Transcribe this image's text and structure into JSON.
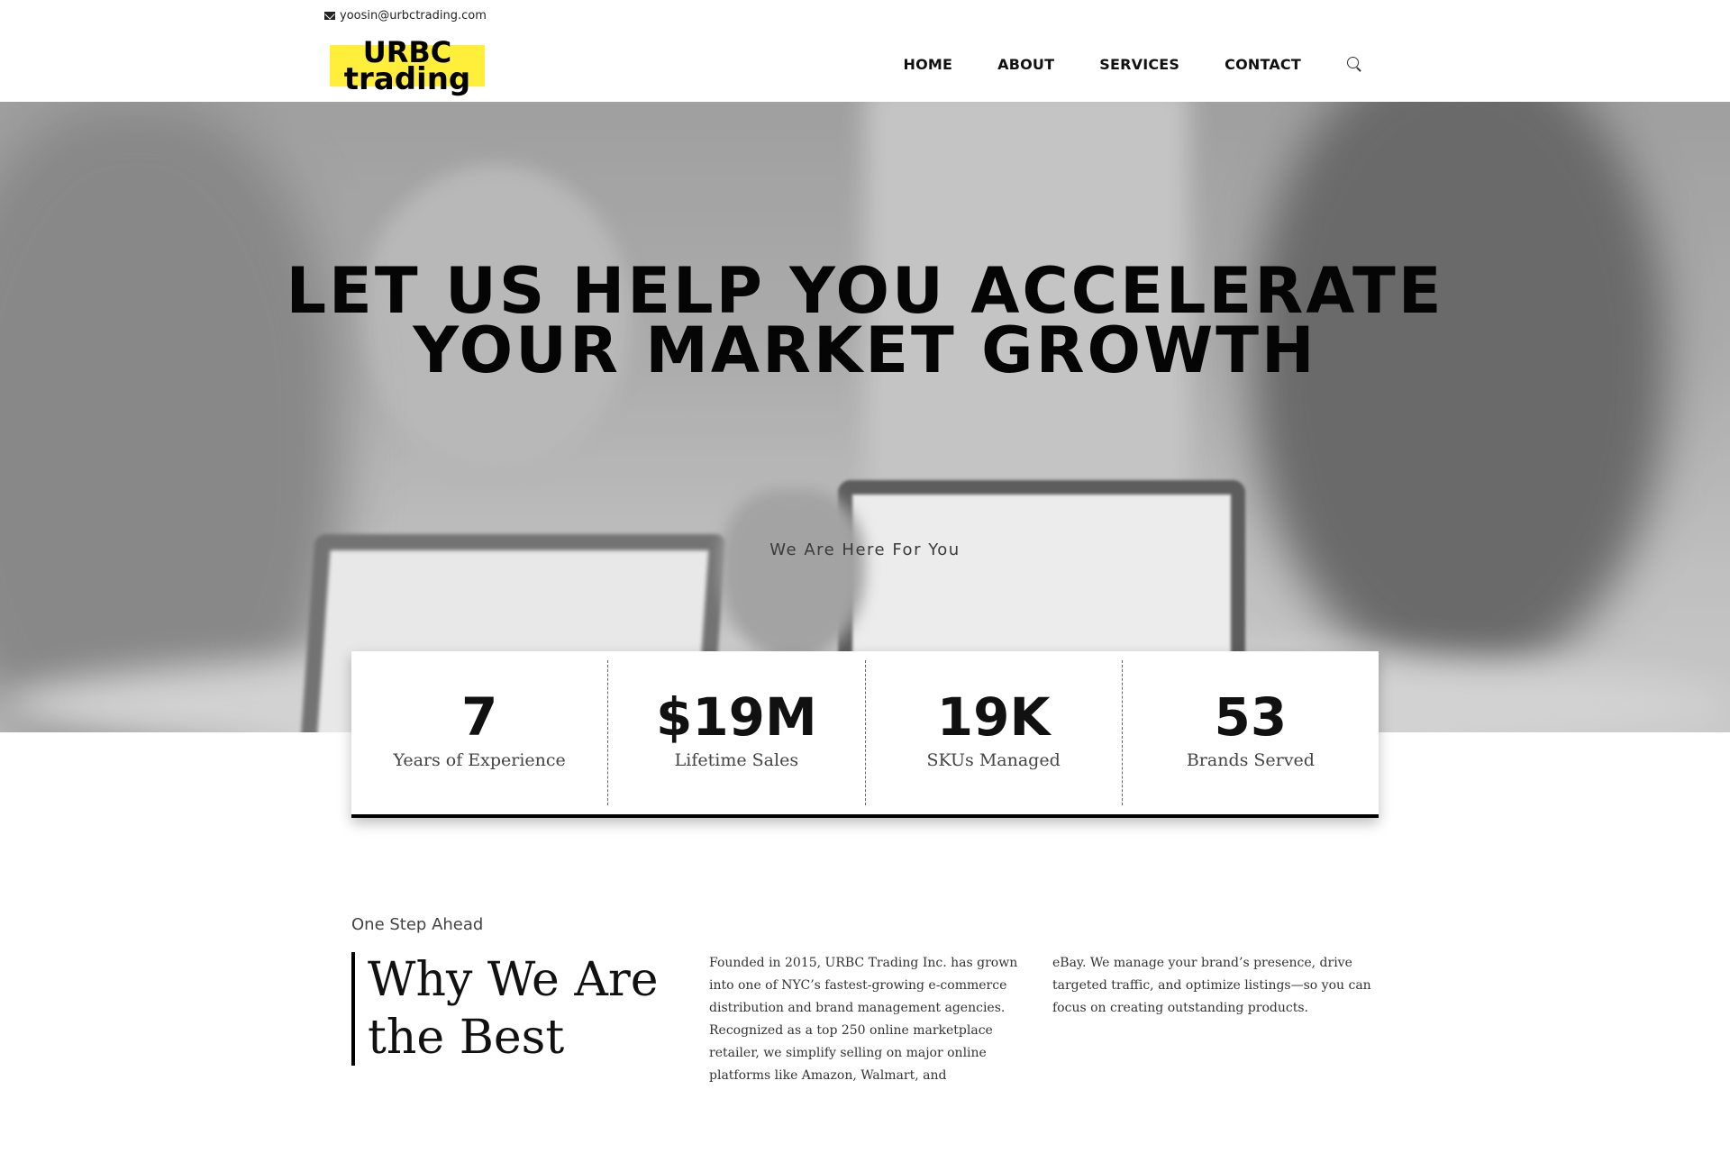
{
  "topbar": {
    "email": "yoosin@urbctrading.com"
  },
  "logo": {
    "line1": "URBC",
    "line2": "trading",
    "highlight_color": "#ffef3a"
  },
  "nav": {
    "items": [
      "HOME",
      "ABOUT",
      "SERVICES",
      "CONTACT"
    ],
    "search_icon": "search-icon"
  },
  "hero": {
    "title_line1": "LET US HELP YOU ACCELERATE",
    "title_line2": "YOUR MARKET GROWTH",
    "subtitle": "We Are Here For You"
  },
  "stats": [
    {
      "value": "7",
      "label": "Years of Experience"
    },
    {
      "value": "$19M",
      "label": "Lifetime Sales"
    },
    {
      "value": "19K",
      "label": "SKUs Managed"
    },
    {
      "value": "53",
      "label": "Brands Served"
    }
  ],
  "about": {
    "eyebrow": "One Step Ahead",
    "title": "Why We Are the Best",
    "paragraph_part1": "Founded in 2015, URBC Trading Inc. has grown into one of NYC’s fastest-growing e-commerce distribution and brand management agencies. Recognized as a top 250 online marketplace retailer, we simplify selling on major online platforms like Amazon, Walmart, and",
    "paragraph_part2": "eBay. We manage your brand’s presence, drive targeted traffic, and optimize listings—so you can focus on creating outstanding products."
  }
}
